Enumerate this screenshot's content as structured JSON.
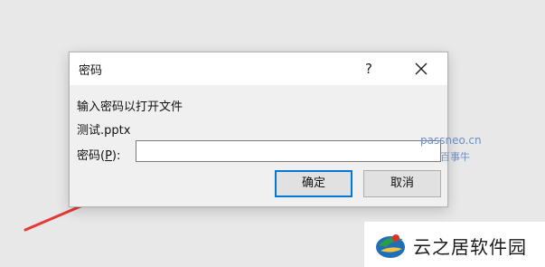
{
  "dialog": {
    "title": "密码",
    "help_label": "?",
    "prompt": "输入密码以打开文件",
    "filename": "测试.pptx",
    "password_label_prefix": "密码(",
    "password_label_accel": "P",
    "password_label_suffix": "):",
    "password_value": "",
    "ok_label": "确定",
    "cancel_label": "取消"
  },
  "watermark": {
    "site": "passneo.cn",
    "brand_cn": "百事牛"
  },
  "corner_brand": {
    "text": "云之居软件园"
  },
  "colors": {
    "dialog_bg": "#f0f0f0",
    "titlebar_bg": "#ffffff",
    "focus_border": "#0078d7",
    "arrow": "#e53935",
    "watermark": "#6e8fc4"
  },
  "icons": {
    "close": "close-icon",
    "arrow": "red-pointer-arrow",
    "logo": "yunzhiju-logo-icon"
  }
}
